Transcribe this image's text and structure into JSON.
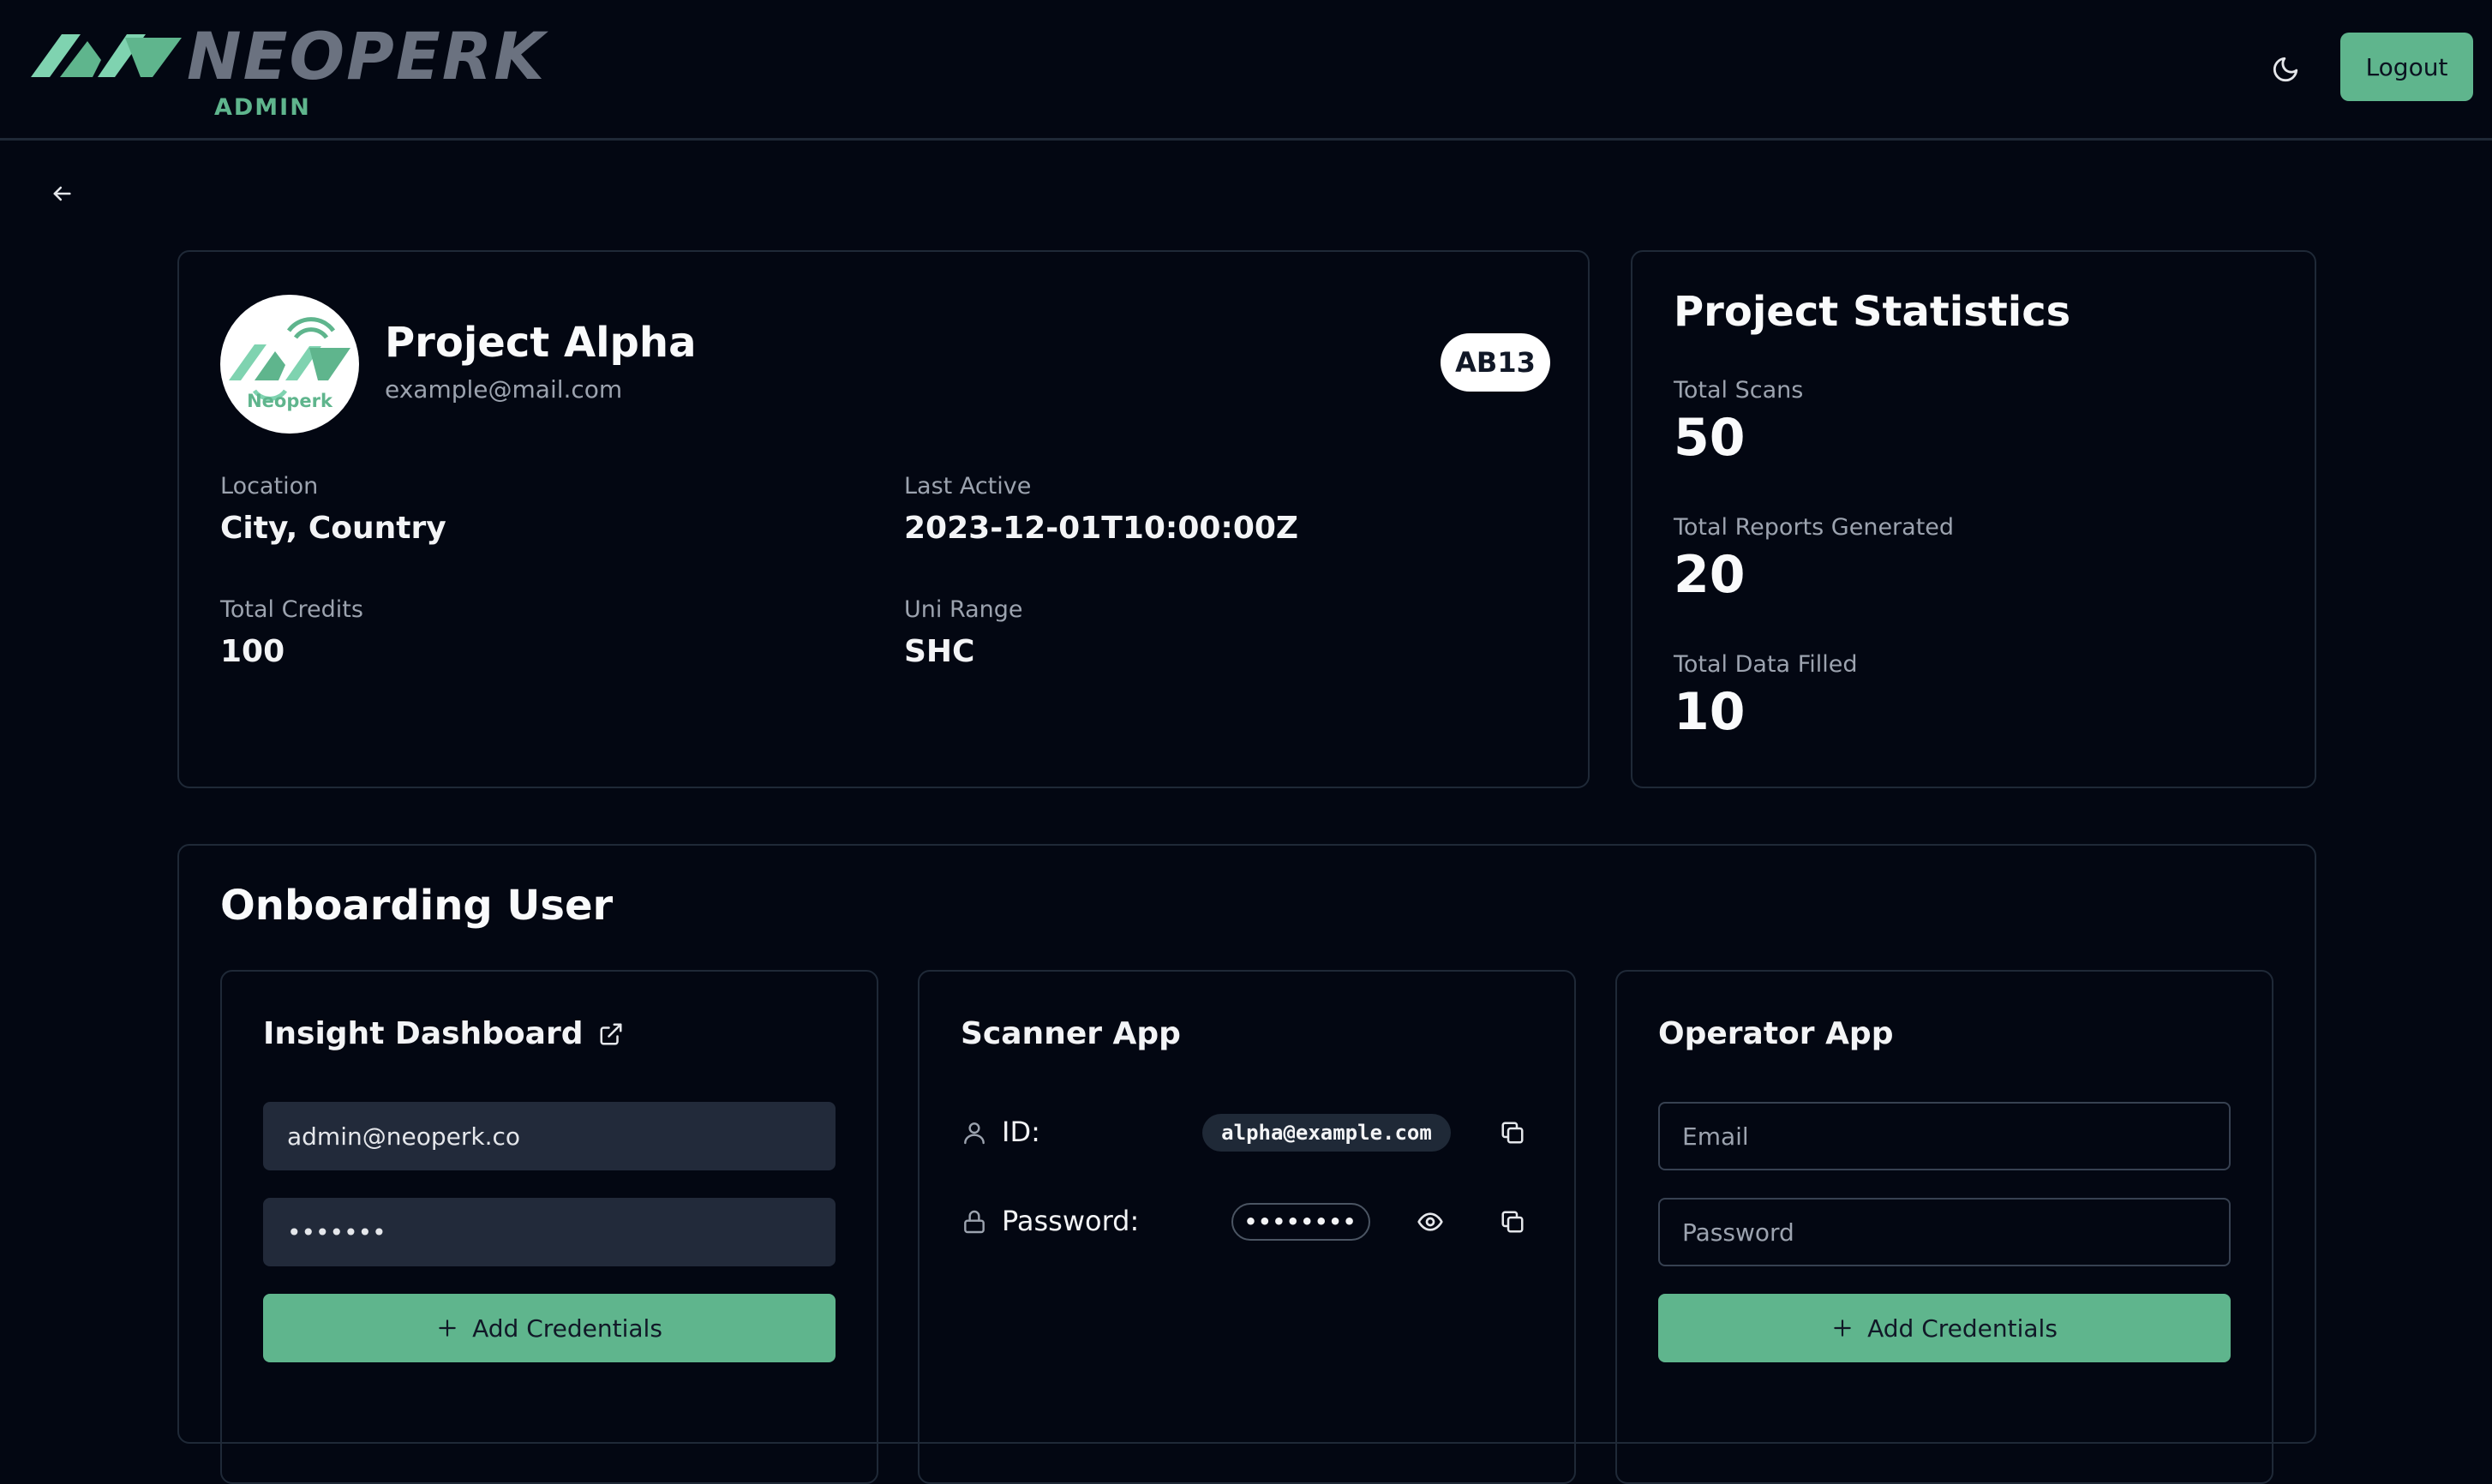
{
  "brand": {
    "name": "NEOPERK",
    "sub": "ADMIN",
    "accent": "#5fb58d",
    "background": "#030712"
  },
  "header": {
    "logout_label": "Logout",
    "theme_icon": "moon-icon"
  },
  "nav": {
    "back_icon": "arrow-left-icon"
  },
  "project": {
    "avatar_label": "Neoperk",
    "name": "Project Alpha",
    "email": "example@mail.com",
    "code": "AB13",
    "fields": [
      {
        "label": "Location",
        "value": "City, Country"
      },
      {
        "label": "Last Active",
        "value": "2023-12-01T10:00:00Z"
      },
      {
        "label": "Total Credits",
        "value": "100"
      },
      {
        "label": "Uni Range",
        "value": "SHC"
      }
    ]
  },
  "stats": {
    "title": "Project Statistics",
    "items": [
      {
        "label": "Total Scans",
        "value": "50"
      },
      {
        "label": "Total Reports Generated",
        "value": "20"
      },
      {
        "label": "Total Data Filled",
        "value": "10"
      }
    ]
  },
  "onboarding": {
    "title": "Onboarding User",
    "insight": {
      "title": "Insight Dashboard",
      "link_icon": "external-link-icon",
      "email_value": "admin@neoperk.co",
      "password_value": "•••••••",
      "add_label": "Add Credentials"
    },
    "scanner": {
      "title": "Scanner App",
      "id_label": "ID:",
      "id_value": "alpha@example.com",
      "password_label": "Password:",
      "password_value": "••••••••"
    },
    "operator": {
      "title": "Operator App",
      "email_placeholder": "Email",
      "password_placeholder": "Password",
      "add_label": "Add Credentials"
    }
  }
}
